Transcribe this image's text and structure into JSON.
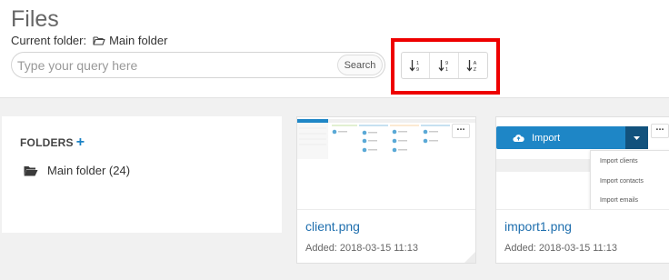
{
  "header": {
    "title": "Files",
    "current_folder_label": "Current folder:",
    "current_folder_name": "Main folder"
  },
  "search": {
    "placeholder": "Type your query here",
    "value": "",
    "button_label": "Search"
  },
  "sort_buttons": [
    {
      "icon": "sort-numeric-asc-icon"
    },
    {
      "icon": "sort-numeric-desc-icon"
    },
    {
      "icon": "sort-alpha-asc-icon"
    }
  ],
  "folders": {
    "heading": "FOLDERS",
    "items": [
      {
        "label": "Main folder (24)"
      }
    ]
  },
  "files": [
    {
      "name": "client.png",
      "added": "Added: 2018-03-15 11:13"
    },
    {
      "name": "import1.png",
      "added": "Added: 2018-03-15 11:13",
      "thumbnail": {
        "button_label": "Import",
        "menu_items": [
          "Import clients",
          "Import contacts",
          "Import emails"
        ]
      }
    }
  ],
  "colors": {
    "accent": "#1e86c6",
    "accent_dark": "#12527d",
    "highlight": "#ee0000",
    "link": "#1f6fae"
  }
}
